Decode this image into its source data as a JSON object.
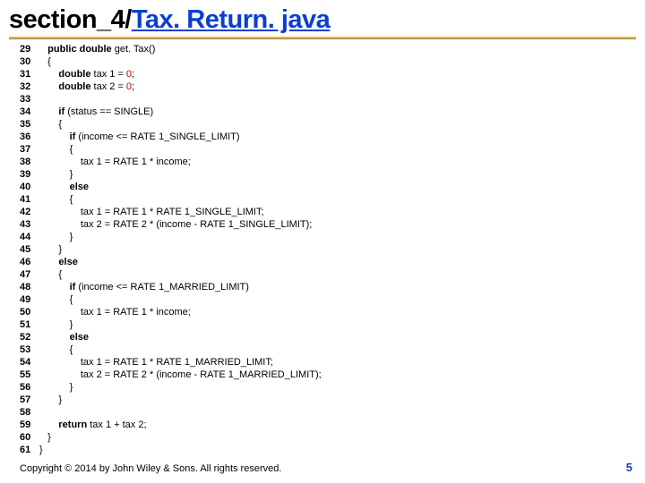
{
  "title": {
    "prefix": "section_4/",
    "link": "Tax. Return. java"
  },
  "lines": [
    {
      "n": "29",
      "indent": 0,
      "html": "<span class='kw'>public double</span> get. Tax()"
    },
    {
      "n": "30",
      "indent": 0,
      "html": "{"
    },
    {
      "n": "31",
      "indent": 1,
      "html": "<span class='kw'>double</span> tax 1 = <span class='lit0'>0</span>;"
    },
    {
      "n": "32",
      "indent": 1,
      "html": "<span class='kw'>double</span> tax 2 = <span class='lit0'>0</span>;"
    },
    {
      "n": "33",
      "indent": 0,
      "html": ""
    },
    {
      "n": "34",
      "indent": 1,
      "html": "<span class='kw'>if</span> (status == SINGLE)"
    },
    {
      "n": "35",
      "indent": 1,
      "html": "{"
    },
    {
      "n": "36",
      "indent": 2,
      "html": "<span class='kw'>if</span> (income &lt;= RATE 1_SINGLE_LIMIT)"
    },
    {
      "n": "37",
      "indent": 2,
      "html": "{"
    },
    {
      "n": "38",
      "indent": 3,
      "html": "tax 1 = RATE 1 * income;"
    },
    {
      "n": "39",
      "indent": 2,
      "html": "}"
    },
    {
      "n": "40",
      "indent": 2,
      "html": "<span class='kw'>else</span>"
    },
    {
      "n": "41",
      "indent": 2,
      "html": "{"
    },
    {
      "n": "42",
      "indent": 3,
      "html": "tax 1 = RATE 1 * RATE 1_SINGLE_LIMIT;"
    },
    {
      "n": "43",
      "indent": 3,
      "html": "tax 2 = RATE 2 * (income - RATE 1_SINGLE_LIMIT);"
    },
    {
      "n": "44",
      "indent": 2,
      "html": "}"
    },
    {
      "n": "45",
      "indent": 1,
      "html": "}"
    },
    {
      "n": "46",
      "indent": 1,
      "html": "<span class='kw'>else</span>"
    },
    {
      "n": "47",
      "indent": 1,
      "html": "{"
    },
    {
      "n": "48",
      "indent": 2,
      "html": "<span class='kw'>if</span> (income &lt;= RATE 1_MARRIED_LIMIT)"
    },
    {
      "n": "49",
      "indent": 2,
      "html": "{"
    },
    {
      "n": "50",
      "indent": 3,
      "html": "tax 1 = RATE 1 * income;"
    },
    {
      "n": "51",
      "indent": 2,
      "html": "}"
    },
    {
      "n": "52",
      "indent": 2,
      "html": "<span class='kw'>else</span>"
    },
    {
      "n": "53",
      "indent": 2,
      "html": "{"
    },
    {
      "n": "54",
      "indent": 3,
      "html": "tax 1 = RATE 1 * RATE 1_MARRIED_LIMIT;"
    },
    {
      "n": "55",
      "indent": 3,
      "html": "tax 2 = RATE 2 * (income - RATE 1_MARRIED_LIMIT);"
    },
    {
      "n": "56",
      "indent": 2,
      "html": "}"
    },
    {
      "n": "57",
      "indent": 1,
      "html": "}"
    },
    {
      "n": "58",
      "indent": 0,
      "html": ""
    },
    {
      "n": "59",
      "indent": 1,
      "html": "<span class='kw'>return</span> tax 1 + tax 2;"
    },
    {
      "n": "60",
      "indent": 0,
      "html": "}"
    },
    {
      "n": "61",
      "indent": -1,
      "html": "}"
    }
  ],
  "footer": {
    "copyright": "Copyright © 2014 by John Wiley & Sons. All rights reserved.",
    "page": "5"
  }
}
